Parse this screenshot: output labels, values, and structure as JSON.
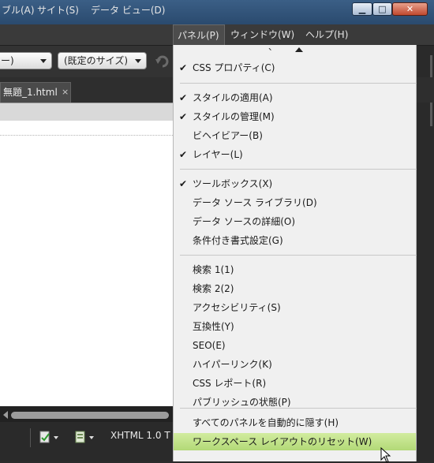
{
  "menubar": {
    "items": [
      {
        "label": "ブル(A)"
      },
      {
        "label": "サイト(S)"
      },
      {
        "label": "データ ビュー(D)"
      },
      {
        "label": "パネル(P)",
        "active": true
      },
      {
        "label": "ウィンドウ(W)"
      },
      {
        "label": "ヘルプ(H)"
      }
    ]
  },
  "window": {
    "minimize": "▁",
    "maximize": "□",
    "close": "✕"
  },
  "toolbar": {
    "combo1_value": "ー)",
    "combo2_value": "(既定のサイズ)"
  },
  "document": {
    "tab_label": "無題_1.html",
    "tab_close": "×",
    "status_text": "XHTML 1.0 T"
  },
  "panel_menu": {
    "top_partial": "、",
    "groups": [
      [
        {
          "label": "CSS プロパティ(C)",
          "checked": true
        }
      ],
      [
        {
          "label": "スタイルの適用(A)",
          "checked": true
        },
        {
          "label": "スタイルの管理(M)",
          "checked": true
        },
        {
          "label": "ビヘイビアー(B)",
          "checked": false
        },
        {
          "label": "レイヤー(L)",
          "checked": true
        }
      ],
      [
        {
          "label": "ツールボックス(X)",
          "checked": true
        },
        {
          "label": "データ ソース ライブラリ(D)",
          "checked": false
        },
        {
          "label": "データ ソースの詳細(O)",
          "checked": false
        },
        {
          "label": "条件付き書式設定(G)",
          "checked": false
        }
      ],
      [
        {
          "label": "検索 1(1)",
          "checked": false
        },
        {
          "label": "検索 2(2)",
          "checked": false
        },
        {
          "label": "アクセシビリティ(S)",
          "checked": false
        },
        {
          "label": "互換性(Y)",
          "checked": false
        },
        {
          "label": "SEO(E)",
          "checked": false
        },
        {
          "label": "ハイパーリンク(K)",
          "checked": false
        },
        {
          "label": "CSS レポート(R)",
          "checked": false
        },
        {
          "label": "パブリッシュの状態(P)",
          "checked": false
        }
      ],
      [
        {
          "label": "すべてのパネルを自動的に隠す(H)",
          "checked": false
        },
        {
          "label": "ワークスペース レイアウトのリセット(W)",
          "checked": false,
          "highlighted": true
        }
      ]
    ],
    "check_glyph": "✔"
  },
  "icons": [
    "minimize-icon",
    "maximize-icon",
    "close-icon",
    "undo-icon",
    "validate-icon",
    "check-page-icon",
    "scroll-up-arrow-icon",
    "mouse-cursor-icon"
  ]
}
